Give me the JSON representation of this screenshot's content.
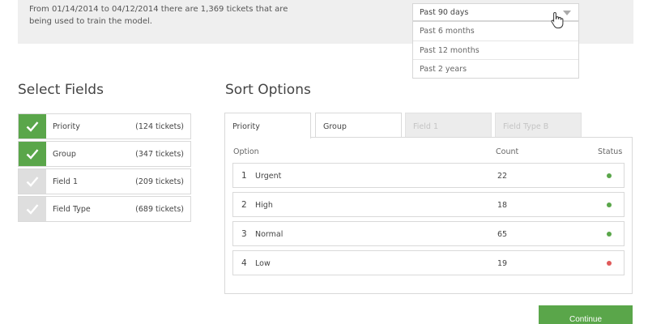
{
  "banner": {
    "text": "From 01/14/2014 to 04/12/2014 there are 1,369 tickets that are being used to train the model."
  },
  "date_range": {
    "selected": "Past 90 days",
    "options": [
      "Past 6 months",
      "Past 12 months",
      "Past 2 years"
    ]
  },
  "select_fields": {
    "title": "Select Fields",
    "items": [
      {
        "label": "Priority",
        "count": "(124 tickets)",
        "checked": true
      },
      {
        "label": "Group",
        "count": "(347 tickets)",
        "checked": true
      },
      {
        "label": "Field 1",
        "count": "(209 tickets)",
        "checked": false
      },
      {
        "label": "Field Type",
        "count": "(689 tickets)",
        "checked": false
      }
    ]
  },
  "sort_options": {
    "title": "Sort Options",
    "tabs": [
      {
        "label": "Priority",
        "state": "active"
      },
      {
        "label": "Group",
        "state": "normal"
      },
      {
        "label": "Field 1",
        "state": "disabled"
      },
      {
        "label": "Field Type B",
        "state": "disabled"
      }
    ],
    "columns": {
      "option": "Option",
      "count": "Count",
      "status": "Status"
    },
    "rows": [
      {
        "num": "1",
        "label": "Urgent",
        "count": "22",
        "status": "green"
      },
      {
        "num": "2",
        "label": "High",
        "count": "18",
        "status": "green"
      },
      {
        "num": "3",
        "label": "Normal",
        "count": "65",
        "status": "green"
      },
      {
        "num": "4",
        "label": "Low",
        "count": "19",
        "status": "red"
      }
    ]
  },
  "actions": {
    "continue_label": "Continue"
  },
  "colors": {
    "accent": "#5aa64a",
    "status_green": "#5aa64a",
    "status_red": "#e05a5a"
  }
}
